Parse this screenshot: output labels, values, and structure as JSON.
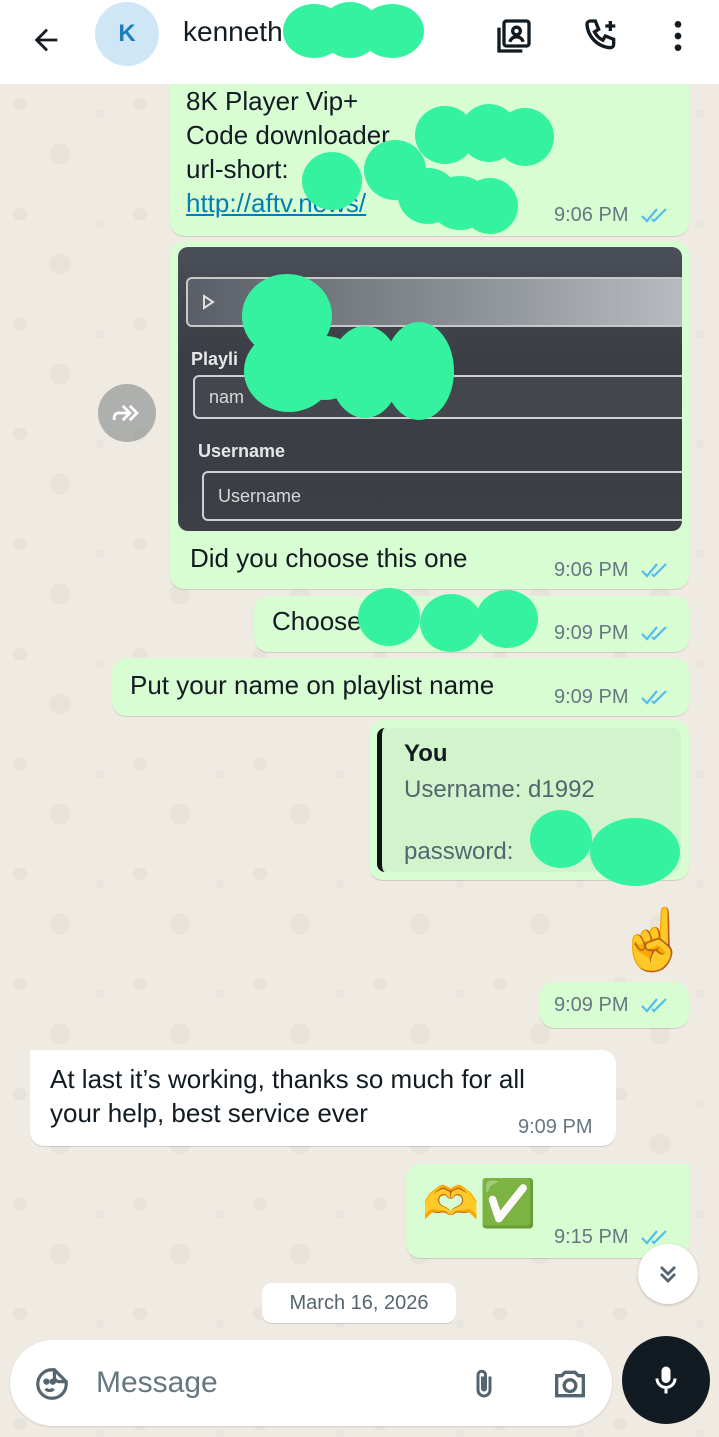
{
  "header": {
    "avatar_letter": "K",
    "contact_name": "kenneth"
  },
  "messages": {
    "m1": {
      "line1": "8K Player Vip+",
      "line2": "Code downloader",
      "line3": "url-short:",
      "link": "http://aftv.news/",
      "time": "9:06 PM"
    },
    "m2": {
      "screenshot": {
        "playlist_label": "Playli",
        "name_field": "nam",
        "username_label": "Username",
        "username_field": "Username"
      },
      "text": "Did you choose this one",
      "time": "9:06 PM"
    },
    "m3": {
      "text": "Choose",
      "time": "9:09 PM"
    },
    "m4": {
      "text": "Put your name on playlist name",
      "time": "9:09 PM"
    },
    "m5": {
      "quote_author": "You",
      "quote_line1": "Username: d1992",
      "quote_line2": "password:",
      "emoji": "☝️",
      "time": "9:09 PM"
    },
    "m6": {
      "line1": "At last it’s working, thanks so much for all",
      "line2": "your help, best service ever",
      "time": "9:09 PM"
    },
    "m7": {
      "emoji": "🫶✅",
      "time": "9:15 PM"
    }
  },
  "date_chip": "March 16, 2026",
  "composer": {
    "placeholder": "Message"
  },
  "colors": {
    "outgoing_bubble": "#d9fdd3",
    "incoming_bubble": "#ffffff",
    "read_ticks": "#53bdeb",
    "redaction": "#35f2a0"
  }
}
